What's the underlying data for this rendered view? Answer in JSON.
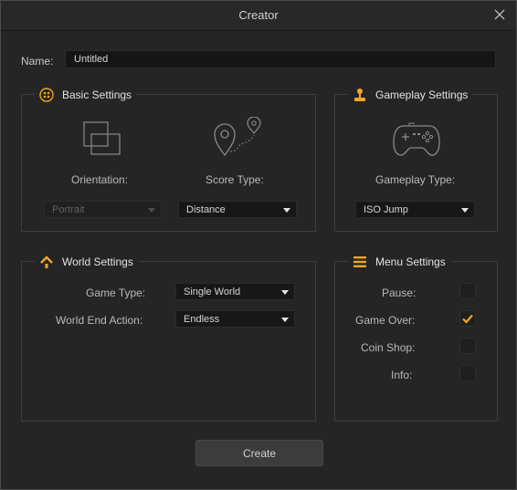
{
  "window": {
    "title": "Creator"
  },
  "name": {
    "label": "Name:",
    "value": "Untitled"
  },
  "basic_settings": {
    "title": "Basic Settings",
    "orientation_label": "Orientation:",
    "orientation_value": "Portrait",
    "score_type_label": "Score Type:",
    "score_type_value": "Distance"
  },
  "gameplay_settings": {
    "title": "Gameplay Settings",
    "gameplay_type_label": "Gameplay Type:",
    "gameplay_type_value": "ISO Jump"
  },
  "world_settings": {
    "title": "World Settings",
    "game_type_label": "Game Type:",
    "game_type_value": "Single World",
    "world_end_label": "World End Action:",
    "world_end_value": "Endless"
  },
  "menu_settings": {
    "title": "Menu Settings",
    "items": [
      {
        "label": "Pause:",
        "checked": false
      },
      {
        "label": "Game Over:",
        "checked": true
      },
      {
        "label": "Coin Shop:",
        "checked": false
      },
      {
        "label": "Info:",
        "checked": false
      }
    ]
  },
  "create_label": "Create",
  "colors": {
    "accent": "#f5a623",
    "background": "#252525"
  }
}
